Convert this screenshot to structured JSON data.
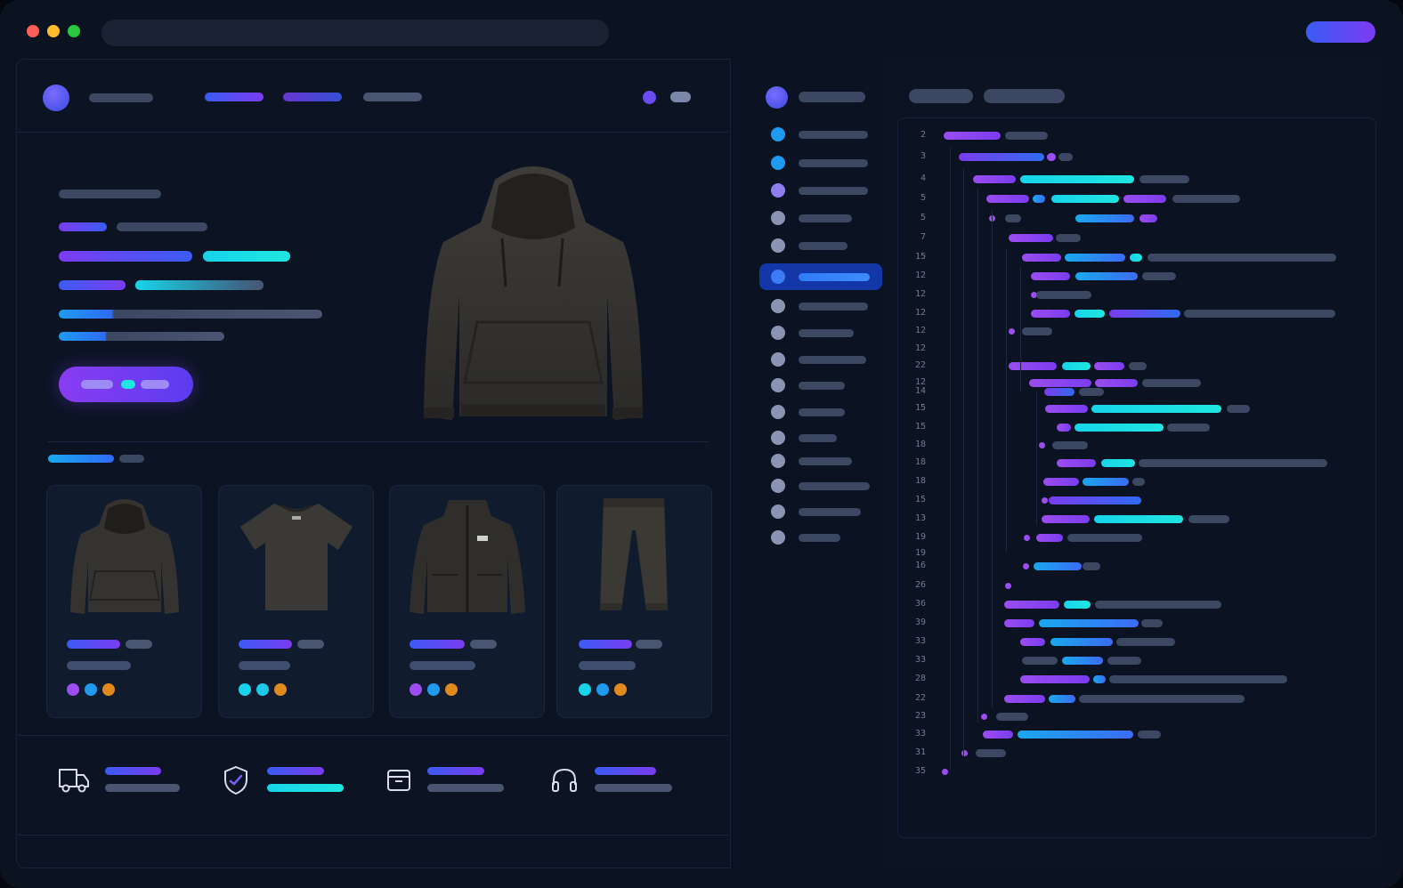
{
  "window": {
    "traffic_lights": [
      "#ff5f57",
      "#febc2e",
      "#28c840"
    ],
    "accent_button_colors": [
      "#3b5bf5",
      "#7a3cf0"
    ]
  },
  "product_detail": {
    "image": "hoodie-image"
  },
  "product_cards": [
    {
      "image": "hoodie-image",
      "swatches": [
        "#9b4df0",
        "#1e9bf0",
        "#e08a1e"
      ]
    },
    {
      "image": "tshirt-image",
      "swatches": [
        "#17d4ea",
        "#1ec8e8",
        "#e08a1e"
      ]
    },
    {
      "image": "jacket-image",
      "swatches": [
        "#9b4df0",
        "#1e9bf0",
        "#e08a1e"
      ]
    },
    {
      "image": "joggers-image",
      "swatches": [
        "#17d4ea",
        "#1e9bf0",
        "#e08a1e"
      ]
    }
  ],
  "features": [
    {
      "icon": "truck-icon"
    },
    {
      "icon": "shield-check-icon"
    },
    {
      "icon": "box-icon"
    },
    {
      "icon": "headset-icon"
    }
  ],
  "code": {
    "line_numbers": [
      "2",
      "3",
      "4",
      "5",
      "5",
      "7",
      "15",
      "12",
      "12",
      "12",
      "12",
      "12",
      "22",
      "12",
      "14",
      "15",
      "15",
      "18",
      "18",
      "18",
      "15",
      "13",
      "19",
      "19",
      "16",
      "26",
      "36",
      "39",
      "33",
      "33",
      "28",
      "22",
      "23",
      "33",
      "31",
      "35"
    ]
  }
}
